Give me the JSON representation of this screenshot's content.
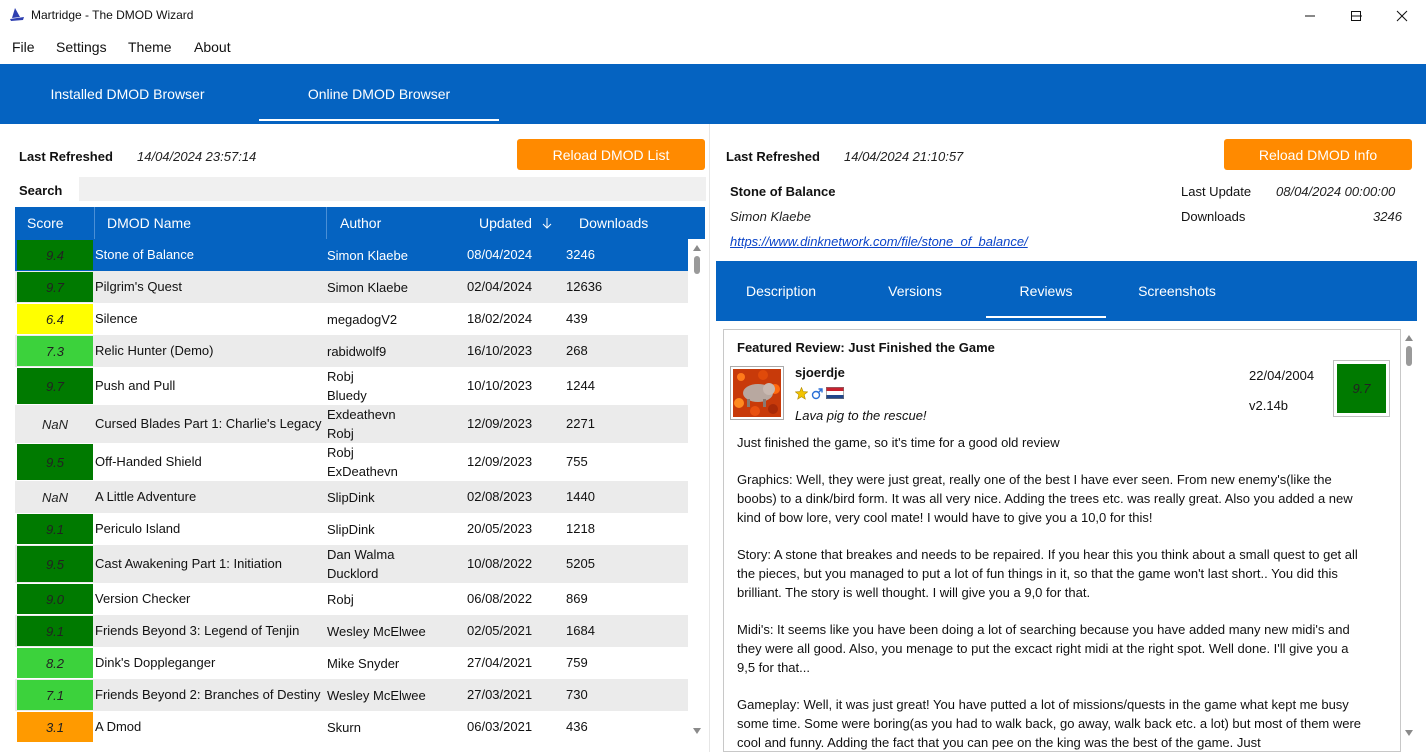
{
  "window": {
    "title": "Martridge - The DMOD Wizard"
  },
  "menu": [
    "File",
    "Settings",
    "Theme",
    "About"
  ],
  "main_tabs": [
    {
      "label": "Installed DMOD Browser",
      "active": false
    },
    {
      "label": "Online DMOD Browser",
      "active": true
    }
  ],
  "left": {
    "last_refreshed_label": "Last Refreshed",
    "last_refreshed_value": "14/04/2024 23:57:14",
    "reload_button": "Reload DMOD List",
    "search_label": "Search",
    "search_value": "",
    "columns": [
      "Score",
      "DMOD Name",
      "Author",
      "Updated",
      "Downloads"
    ],
    "sort_column": "Updated",
    "rows": [
      {
        "score": "9.4",
        "name": "Stone of Balance",
        "author": [
          "Simon Klaebe"
        ],
        "updated": "08/04/2024",
        "downloads": "3246",
        "color": "#007a00",
        "selected": true
      },
      {
        "score": "9.7",
        "name": "Pilgrim's Quest",
        "author": [
          "Simon Klaebe"
        ],
        "updated": "02/04/2024",
        "downloads": "12636",
        "color": "#007a00"
      },
      {
        "score": "6.4",
        "name": "Silence",
        "author": [
          "megadogV2"
        ],
        "updated": "18/02/2024",
        "downloads": "439",
        "color": "#ffff00"
      },
      {
        "score": "7.3",
        "name": "Relic Hunter (Demo)",
        "author": [
          "rabidwolf9"
        ],
        "updated": "16/10/2023",
        "downloads": "268",
        "color": "#3cd23c"
      },
      {
        "score": "9.7",
        "name": "Push and Pull",
        "author": [
          "Robj",
          "Bluedy"
        ],
        "updated": "10/10/2023",
        "downloads": "1244",
        "color": "#007a00"
      },
      {
        "score": "NaN",
        "name": "Cursed Blades Part 1: Charlie's Legacy",
        "author": [
          "Exdeathevn",
          "Robj"
        ],
        "updated": "12/09/2023",
        "downloads": "2271",
        "color": ""
      },
      {
        "score": "9.5",
        "name": "Off-Handed Shield",
        "author": [
          "Robj",
          "ExDeathevn"
        ],
        "updated": "12/09/2023",
        "downloads": "755",
        "color": "#007a00"
      },
      {
        "score": "NaN",
        "name": "A Little Adventure",
        "author": [
          "SlipDink"
        ],
        "updated": "02/08/2023",
        "downloads": "1440",
        "color": ""
      },
      {
        "score": "9.1",
        "name": "Periculo Island",
        "author": [
          "SlipDink"
        ],
        "updated": "20/05/2023",
        "downloads": "1218",
        "color": "#007a00"
      },
      {
        "score": "9.5",
        "name": "Cast Awakening Part 1: Initiation",
        "author": [
          "Dan Walma",
          "Ducklord"
        ],
        "updated": "10/08/2022",
        "downloads": "5205",
        "color": "#007a00"
      },
      {
        "score": "9.0",
        "name": "Version Checker",
        "author": [
          "Robj"
        ],
        "updated": "06/08/2022",
        "downloads": "869",
        "color": "#007a00"
      },
      {
        "score": "9.1",
        "name": "Friends Beyond 3: Legend of Tenjin",
        "author": [
          "Wesley McElwee"
        ],
        "updated": "02/05/2021",
        "downloads": "1684",
        "color": "#007a00"
      },
      {
        "score": "8.2",
        "name": "Dink's Doppleganger",
        "author": [
          "Mike Snyder"
        ],
        "updated": "27/04/2021",
        "downloads": "759",
        "color": "#3cd23c"
      },
      {
        "score": "7.1",
        "name": "Friends Beyond 2: Branches of Destiny",
        "author": [
          "Wesley McElwee"
        ],
        "updated": "27/03/2021",
        "downloads": "730",
        "color": "#3cd23c"
      },
      {
        "score": "3.1",
        "name": "A Dmod",
        "author": [
          "Skurn"
        ],
        "updated": "06/03/2021",
        "downloads": "436",
        "color": "#ff9a00"
      }
    ]
  },
  "right": {
    "last_refreshed_label": "Last Refreshed",
    "last_refreshed_value": "14/04/2024 21:10:57",
    "reload_button": "Reload DMOD Info",
    "dmod_name": "Stone of Balance",
    "dmod_author": "Simon Klaebe",
    "last_update_label": "Last Update",
    "last_update_value": "08/04/2024 00:00:00",
    "downloads_label": "Downloads",
    "downloads_value": "3246",
    "link": "https://www.dinknetwork.com/file/stone_of_balance/",
    "sub_tabs": [
      {
        "label": "Description",
        "active": false
      },
      {
        "label": "Versions",
        "active": false
      },
      {
        "label": "Reviews",
        "active": true
      },
      {
        "label": "Screenshots",
        "active": false
      }
    ],
    "review": {
      "title": "Featured Review: Just Finished the Game",
      "reviewer": "sjoerdje",
      "tagline": "Lava pig to the rescue!",
      "date": "22/04/2004",
      "version": "v2.14b",
      "score": "9.7",
      "score_color": "#007a00",
      "paragraphs": [
        "Just finished the game, so it's time for a good old review",
        "Graphics: Well, they were just great, really one of the best I have ever seen. From new enemy's(like the boobs) to a dink/bird form. It was all very nice. Adding the trees etc. was really great. Also you added a new kind of bow lore, very cool mate! I would have to give you a 10,0 for this!",
        "Story: A stone that breakes and needs to be repaired. If you hear this you think about a small quest to get all the pieces, but you managed to put a lot of fun things in it, so that the game won't last short.. You did this brilliant. The story is well thought. I will give you a 9,0 for that.",
        "Midi's: It seems like you have been doing a lot of searching because you have added many new midi's and they were all good. Also, you menage to put the excact right midi at the right spot. Well done. I'll give you a 9,5 for that...",
        "Gameplay: Well, it was just great! You have putted a lot of missions/quests in the game what kept me busy some time. Some were boring(as you had to walk back, go away, walk back etc. a lot) but most of them were cool and funny. Adding the fact that you can pee on the king was the best of the game. Just"
      ]
    }
  }
}
